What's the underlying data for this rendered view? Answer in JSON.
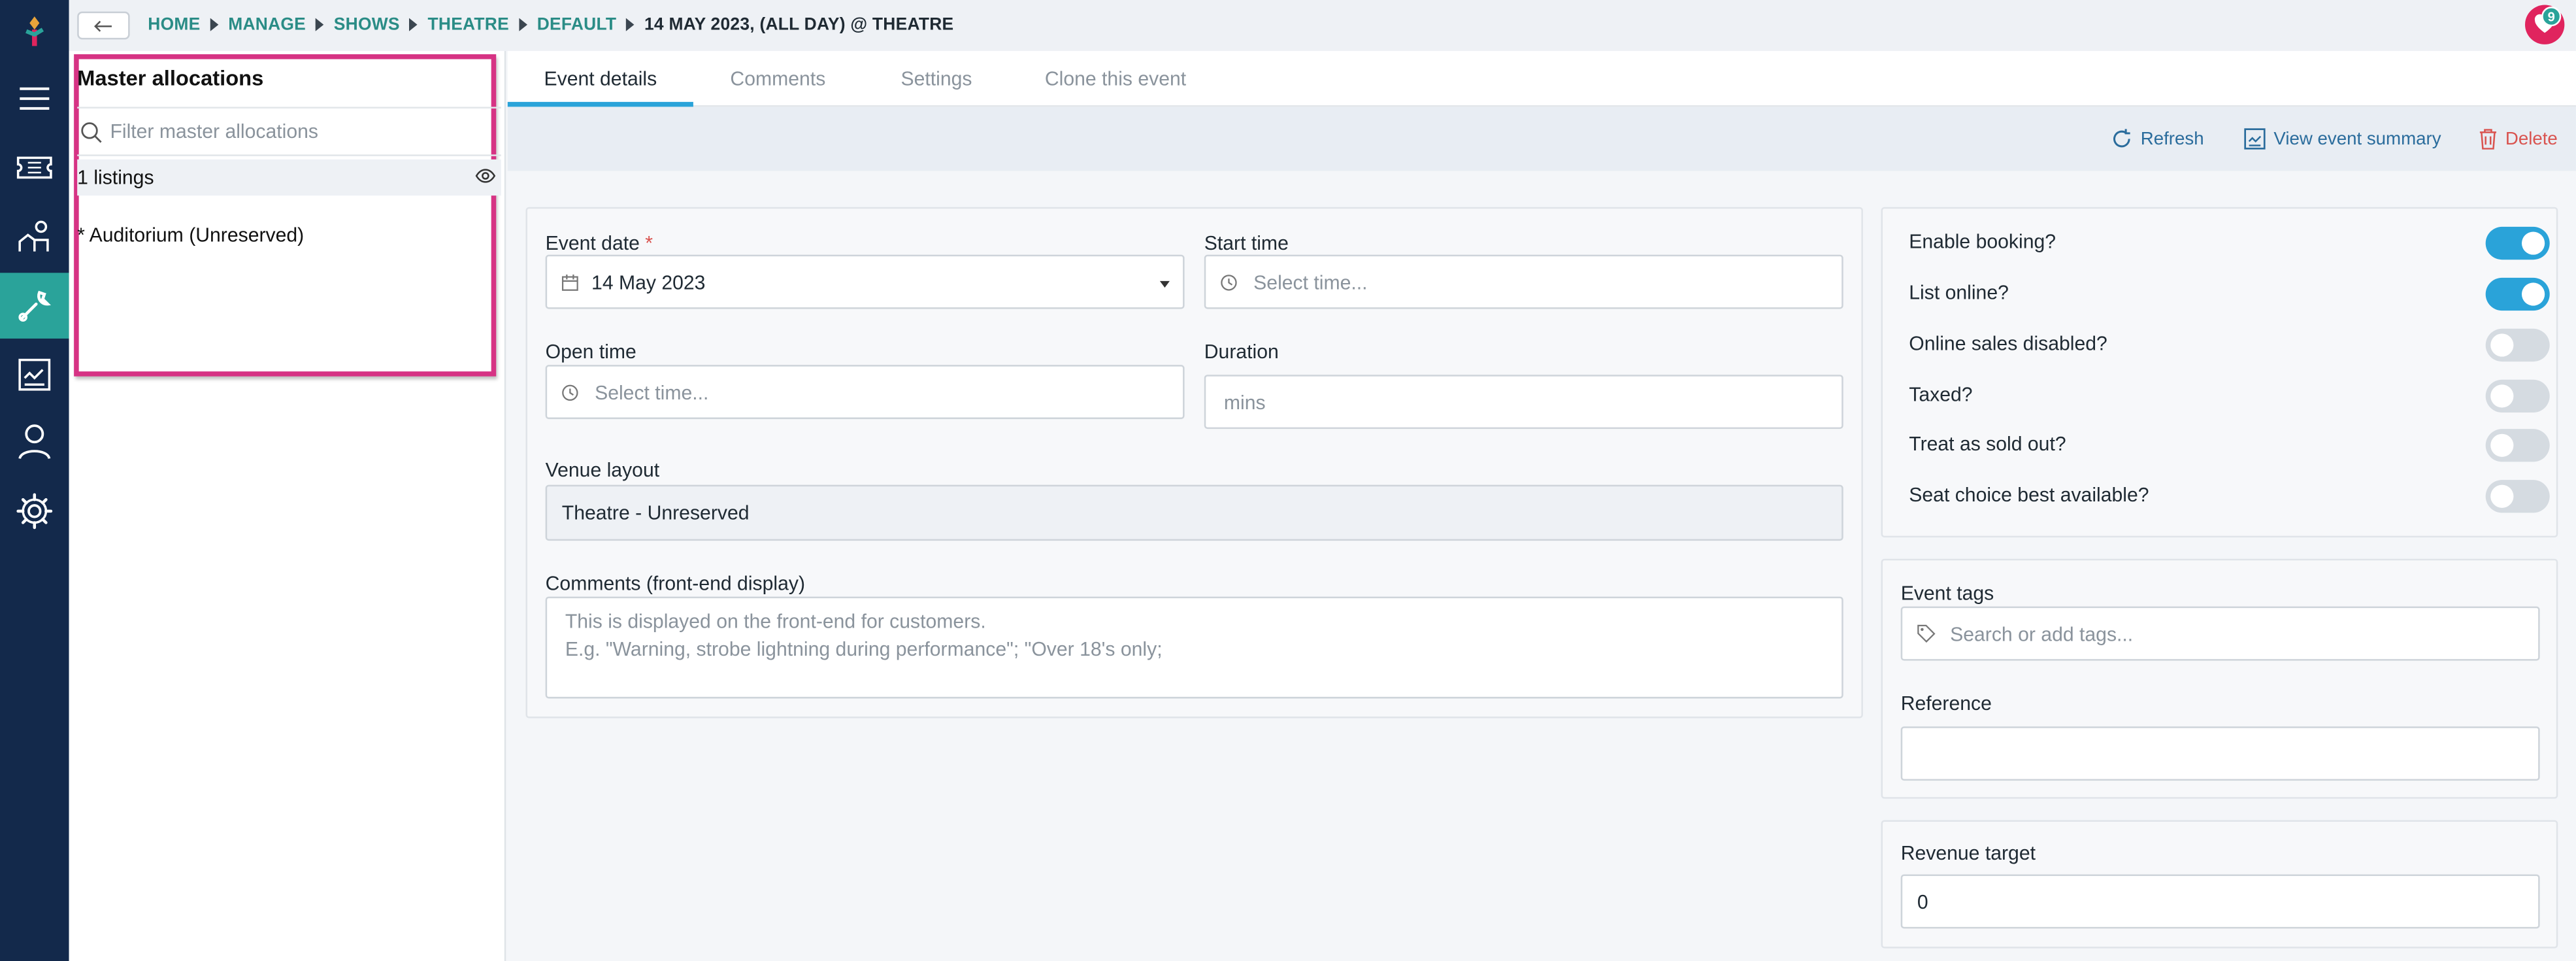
{
  "breadcrumb": {
    "items": [
      "HOME",
      "MANAGE",
      "SHOWS",
      "THEATRE",
      "DEFAULT"
    ],
    "current": "14 MAY 2023, (ALL DAY) @ THEATRE"
  },
  "user": {
    "notification_count": "9"
  },
  "master_allocations": {
    "title": "Master allocations",
    "filter_placeholder": "Filter master allocations",
    "listings_label": "1 listings",
    "items": [
      "* Auditorium (Unreserved)"
    ]
  },
  "tabs": [
    "Event details",
    "Comments",
    "Settings",
    "Clone this event"
  ],
  "actions": {
    "refresh": "Refresh",
    "view_summary": "View event summary",
    "delete": "Delete"
  },
  "form": {
    "event_date": {
      "label": "Event date",
      "required_mark": "*",
      "value": "14 May 2023"
    },
    "start_time": {
      "label": "Start time",
      "placeholder": "Select time..."
    },
    "open_time": {
      "label": "Open time",
      "placeholder": "Select time..."
    },
    "duration": {
      "label": "Duration",
      "placeholder": "mins"
    },
    "venue_layout": {
      "label": "Venue layout",
      "value": "Theatre - Unreserved"
    },
    "comments": {
      "label": "Comments (front-end display)",
      "placeholder_line1": "This is displayed on the front-end for customers.",
      "placeholder_line2": "E.g. \"Warning, strobe lightning during performance\"; \"Over 18's only;"
    }
  },
  "toggles": [
    {
      "label": "Enable booking?",
      "on": true
    },
    {
      "label": "List online?",
      "on": true
    },
    {
      "label": "Online sales disabled?",
      "on": false
    },
    {
      "label": "Taxed?",
      "on": false
    },
    {
      "label": "Treat as sold out?",
      "on": false
    },
    {
      "label": "Seat choice best available?",
      "on": false
    }
  ],
  "side_fields": {
    "event_tags": {
      "label": "Event tags",
      "placeholder": "Search or add tags..."
    },
    "reference": {
      "label": "Reference",
      "value": ""
    },
    "revenue_target": {
      "label": "Revenue target",
      "value": "0"
    }
  },
  "colors": {
    "nav_bg": "#13294b",
    "accent": "#2aa3d9",
    "teal": "#2aa39a",
    "highlight_border": "#d63384",
    "danger": "#d9534f"
  }
}
